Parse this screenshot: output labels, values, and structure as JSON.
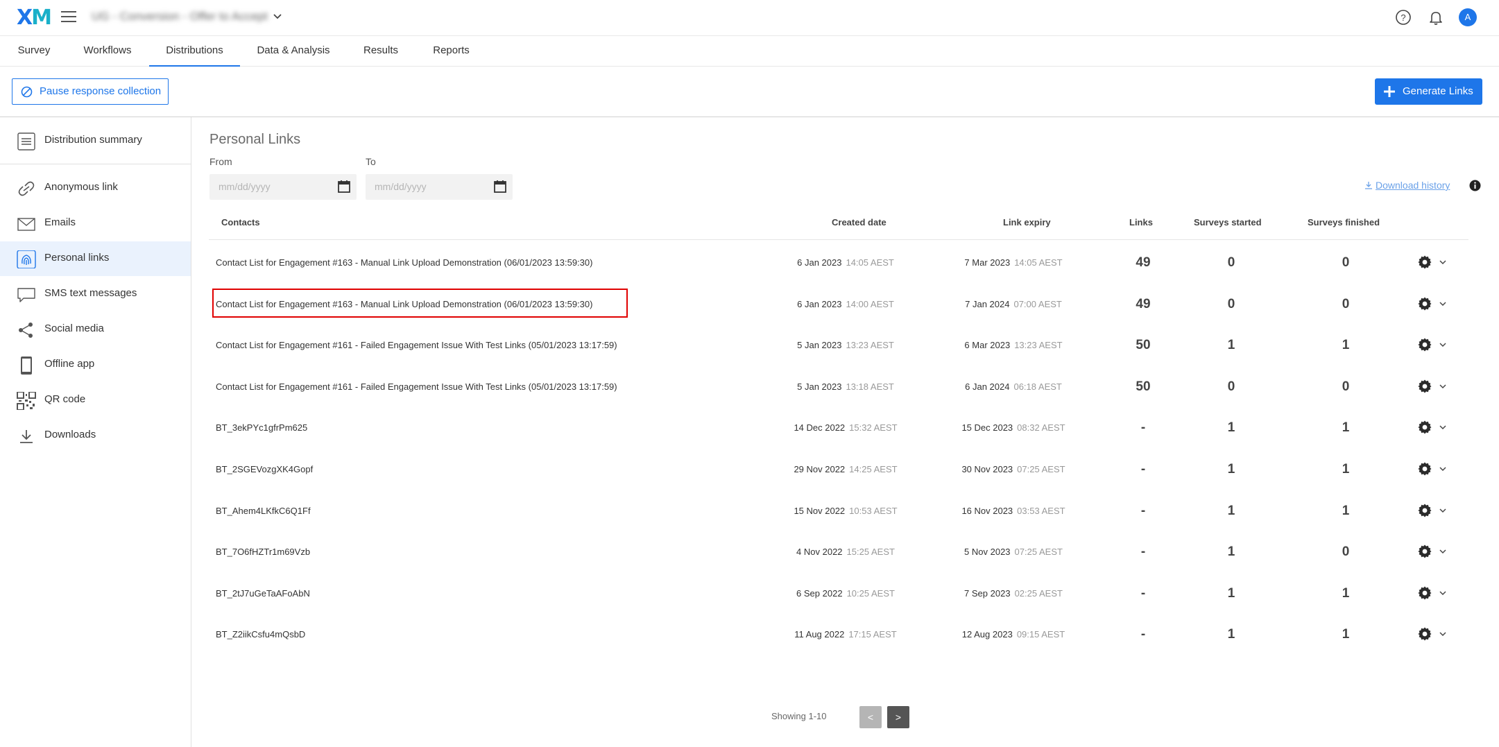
{
  "topbar": {
    "logo_x": "X",
    "logo_m": "M",
    "project_name": "UG - Conversion - Offer to Accept",
    "avatar_initial": "A"
  },
  "tabs": [
    {
      "label": "Survey"
    },
    {
      "label": "Workflows"
    },
    {
      "label": "Distributions",
      "active": true
    },
    {
      "label": "Data & Analysis"
    },
    {
      "label": "Results"
    },
    {
      "label": "Reports"
    }
  ],
  "actions": {
    "pause_label": "Pause response collection",
    "generate_label": "Generate Links"
  },
  "sidebar": {
    "items": [
      {
        "label": "Distribution summary",
        "icon": "list-icon"
      },
      {
        "label": "Anonymous link",
        "icon": "link-icon"
      },
      {
        "label": "Emails",
        "icon": "envelope-icon"
      },
      {
        "label": "Personal links",
        "icon": "fingerprint-icon",
        "active": true
      },
      {
        "label": "SMS text messages",
        "icon": "message-icon"
      },
      {
        "label": "Social media",
        "icon": "share-icon"
      },
      {
        "label": "Offline app",
        "icon": "tablet-icon"
      },
      {
        "label": "QR code",
        "icon": "qr-code-icon"
      },
      {
        "label": "Downloads",
        "icon": "download-icon"
      }
    ]
  },
  "main": {
    "title": "Personal Links",
    "from_label": "From",
    "to_label": "To",
    "date_placeholder": "mm/dd/yyyy",
    "download_history": "Download history"
  },
  "table": {
    "columns": [
      "Contacts",
      "Created date",
      "Link expiry",
      "Links",
      "Surveys started",
      "Surveys finished"
    ],
    "rows": [
      {
        "name": "Contact List for Engagement #163 - Manual Link Upload Demonstration (06/01/2023 13:59:30)",
        "created_date": "6 Jan 2023",
        "created_time": "14:05 AEST",
        "expiry_date": "7 Mar 2023",
        "expiry_time": "14:05 AEST",
        "links": "49",
        "started": "0",
        "finished": "0"
      },
      {
        "name": "Contact List for Engagement #163 - Manual Link Upload Demonstration (06/01/2023 13:59:30)",
        "created_date": "6 Jan 2023",
        "created_time": "14:00 AEST",
        "expiry_date": "7 Jan 2024",
        "expiry_time": "07:00 AEST",
        "links": "49",
        "started": "0",
        "finished": "0",
        "highlighted": true
      },
      {
        "name": "Contact List for Engagement #161 - Failed Engagement Issue With Test Links (05/01/2023 13:17:59)",
        "created_date": "5 Jan 2023",
        "created_time": "13:23 AEST",
        "expiry_date": "6 Mar 2023",
        "expiry_time": "13:23 AEST",
        "links": "50",
        "started": "1",
        "finished": "1"
      },
      {
        "name": "Contact List for Engagement #161 - Failed Engagement Issue With Test Links (05/01/2023 13:17:59)",
        "created_date": "5 Jan 2023",
        "created_time": "13:18 AEST",
        "expiry_date": "6 Jan 2024",
        "expiry_time": "06:18 AEST",
        "links": "50",
        "started": "0",
        "finished": "0"
      },
      {
        "name": "BT_3ekPYc1gfrPm625",
        "created_date": "14 Dec 2022",
        "created_time": "15:32 AEST",
        "expiry_date": "15 Dec 2023",
        "expiry_time": "08:32 AEST",
        "links": "-",
        "started": "1",
        "finished": "1"
      },
      {
        "name": "BT_2SGEVozgXK4Gopf",
        "created_date": "29 Nov 2022",
        "created_time": "14:25 AEST",
        "expiry_date": "30 Nov 2023",
        "expiry_time": "07:25 AEST",
        "links": "-",
        "started": "1",
        "finished": "1"
      },
      {
        "name": "BT_Ahem4LKfkC6Q1Ff",
        "created_date": "15 Nov 2022",
        "created_time": "10:53 AEST",
        "expiry_date": "16 Nov 2023",
        "expiry_time": "03:53 AEST",
        "links": "-",
        "started": "1",
        "finished": "1"
      },
      {
        "name": "BT_7O6fHZTr1m69Vzb",
        "created_date": "4 Nov 2022",
        "created_time": "15:25 AEST",
        "expiry_date": "5 Nov 2023",
        "expiry_time": "07:25 AEST",
        "links": "-",
        "started": "1",
        "finished": "0"
      },
      {
        "name": "BT_2tJ7uGeTaAFoAbN",
        "created_date": "6 Sep 2022",
        "created_time": "10:25 AEST",
        "expiry_date": "7 Sep 2023",
        "expiry_time": "02:25 AEST",
        "links": "-",
        "started": "1",
        "finished": "1"
      },
      {
        "name": "BT_Z2iikCsfu4mQsbD",
        "created_date": "11 Aug 2022",
        "created_time": "17:15 AEST",
        "expiry_date": "12 Aug 2023",
        "expiry_time": "09:15 AEST",
        "links": "-",
        "started": "1",
        "finished": "1"
      }
    ]
  },
  "pagination": {
    "showing": "Showing 1-10",
    "prev": "<",
    "next": ">"
  },
  "colors": {
    "accent": "#1e76e9",
    "highlight_box": "#e00000",
    "pager_prev": "#b5b5b5",
    "pager_next": "#555555"
  }
}
